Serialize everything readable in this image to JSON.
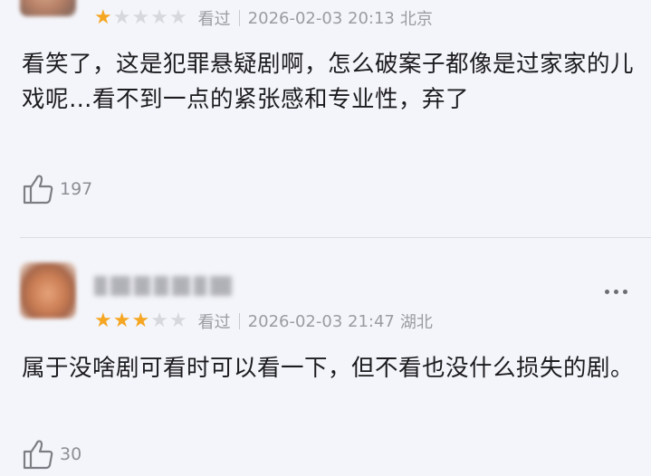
{
  "reviews": [
    {
      "rating": 1,
      "status": "看过",
      "datetime": "2026-02-03 20:13",
      "location": "北京",
      "text": "看笑了，这是犯罪悬疑剧啊，怎么破案子都像是过家家的儿戏呢…看不到一点的紧张感和专业性，弃了",
      "likes": "197"
    },
    {
      "rating": 3,
      "status": "看过",
      "datetime": "2026-02-03 21:47",
      "location": "湖北",
      "text": "属于没啥剧可看时可以看一下，但不看也没什么损失的剧。",
      "likes": "30"
    }
  ],
  "icons": {
    "like": "thumbs-up-icon",
    "more": "more-dots-icon",
    "star": "star-icon"
  },
  "colors": {
    "star_on": "#f5a623",
    "star_off": "#d7d8de",
    "meta": "#9b9ca3",
    "text": "#1c1c1f"
  }
}
